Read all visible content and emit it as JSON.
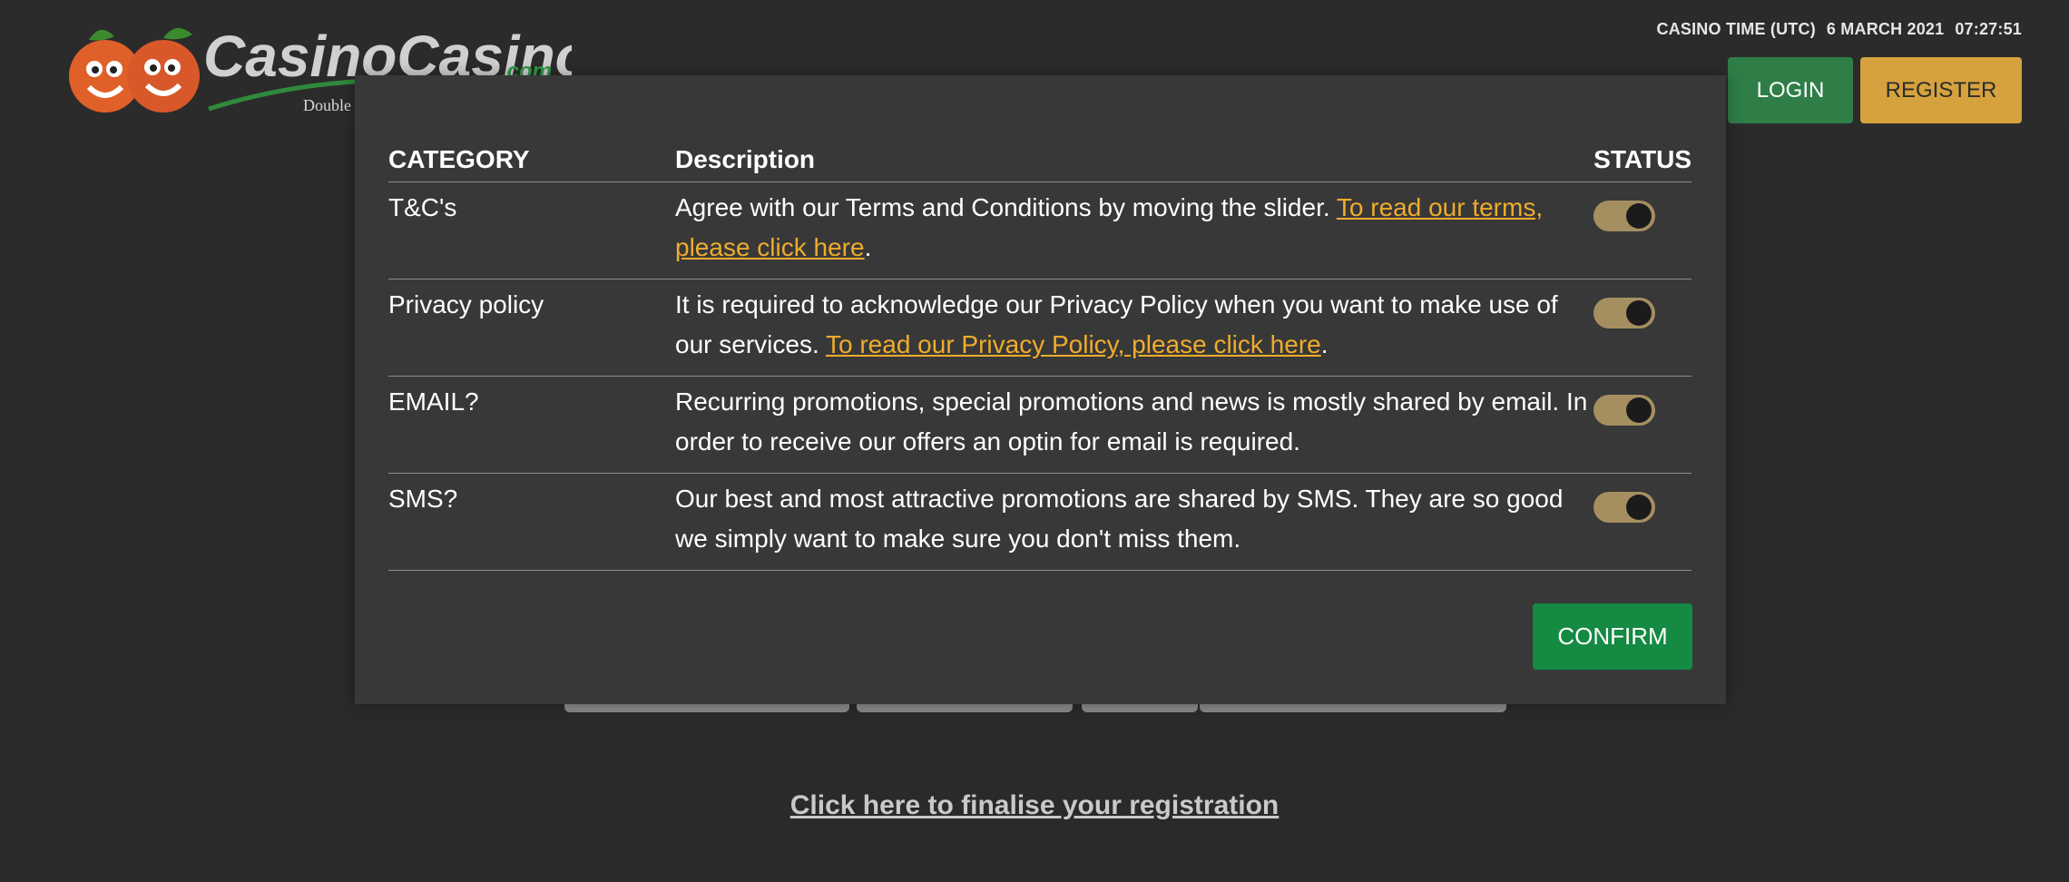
{
  "header": {
    "logo_text": "CasinoCasino",
    "logo_suffix": ".com",
    "logo_tagline": "Double",
    "clock_label": "CASINO TIME (UTC)",
    "clock_date": "6 MARCH 2021",
    "clock_time": "07:27:51",
    "login_label": "LOGIN",
    "register_label": "REGISTER"
  },
  "modal": {
    "headers": {
      "category": "CATEGORY",
      "description": "Description",
      "status": "STATUS"
    },
    "rows": [
      {
        "category": "T&C's",
        "text": "Agree with our Terms and Conditions by moving the slider. ",
        "link": "To read our terms, please click here",
        "after": ".",
        "status": true
      },
      {
        "category": "Privacy policy",
        "text": "It is required to acknowledge our Privacy Policy when you want to make use of our services. ",
        "link": "To read our Privacy Policy, please click here",
        "after": ".",
        "status": true
      },
      {
        "category": "EMAIL?",
        "text": "Recurring promotions, special promotions and news is mostly shared by email. In order to receive our offers an optin for email is required.",
        "link": "",
        "after": "",
        "status": true
      },
      {
        "category": "SMS?",
        "text": "Our best and most attractive promotions are shared by SMS. They are so good we simply want to make sure you don't miss them.",
        "link": "",
        "after": "",
        "status": true
      }
    ],
    "confirm_label": "CONFIRM"
  },
  "page": {
    "finalise_link": "Click here to finalise your registration"
  },
  "colors": {
    "background": "#2a2a2a",
    "modal": "#383838",
    "link": "#f0ac2c",
    "login": "#2f7d47",
    "register": "#d6a23d",
    "confirm": "#148a42",
    "toggle_on": "#a58f61"
  }
}
